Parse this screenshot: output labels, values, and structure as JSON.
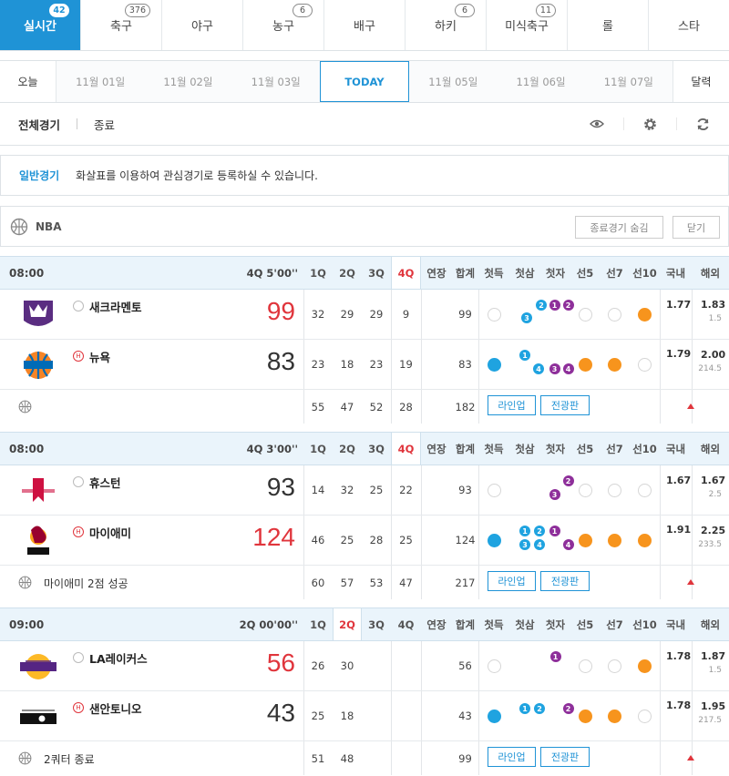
{
  "sports": [
    {
      "label": "실시간",
      "badge": "42",
      "active": true
    },
    {
      "label": "축구",
      "badge": "376"
    },
    {
      "label": "야구",
      "badge": ""
    },
    {
      "label": "농구",
      "badge": "6"
    },
    {
      "label": "배구",
      "badge": ""
    },
    {
      "label": "하키",
      "badge": "6"
    },
    {
      "label": "미식축구",
      "badge": "11"
    },
    {
      "label": "롤",
      "badge": ""
    },
    {
      "label": "스타",
      "badge": ""
    }
  ],
  "dates": {
    "left": "오늘",
    "items": [
      "11월 01일",
      "11월 02일",
      "11월 03일",
      "TODAY",
      "11월 05일",
      "11월 06일",
      "11월 07일"
    ],
    "right": "달력"
  },
  "filter": {
    "all": "전체경기",
    "finished": "종료"
  },
  "notice": {
    "title": "일반경기",
    "text": "화살표를 이용하여 관심경기로 등록하실 수 있습니다."
  },
  "league": {
    "name": "NBA",
    "hide_finished": "종료경기 숨김",
    "close": "닫기"
  },
  "columns": {
    "q1": "1Q",
    "q2": "2Q",
    "q3": "3Q",
    "q4": "4Q",
    "ot": "연장",
    "total": "합계",
    "first_score": "첫득",
    "first_3": "첫삼",
    "first_ft": "첫자",
    "to5": "선5",
    "to7": "선7",
    "to10": "선10",
    "domestic": "국내",
    "overseas": "해외"
  },
  "buttons": {
    "lineup": "라인업",
    "broadcast": "전광판"
  },
  "games": [
    {
      "time": "08:00",
      "status": "4Q 5'00''",
      "hl": "4Q",
      "away": {
        "name": "새크라멘토",
        "score": "99",
        "scoreRed": true,
        "q": [
          "32",
          "29",
          "29",
          "9"
        ],
        "ot": "",
        "total": "99",
        "dom": "1.77",
        "ovs": "1.83",
        "ovs_sub": "1.5"
      },
      "home": {
        "name": "뉴욕",
        "score": "83",
        "scoreRed": false,
        "q": [
          "23",
          "18",
          "23",
          "19"
        ],
        "ot": "",
        "total": "83",
        "dom": "1.79",
        "ovs": "2.00",
        "ovs_sub": "214.5"
      },
      "foot": {
        "text": "",
        "q": [
          "55",
          "47",
          "52",
          "28"
        ],
        "total": "182"
      }
    },
    {
      "time": "08:00",
      "status": "4Q 3'00''",
      "hl": "4Q",
      "away": {
        "name": "휴스턴",
        "score": "93",
        "scoreRed": false,
        "q": [
          "14",
          "32",
          "25",
          "22"
        ],
        "ot": "",
        "total": "93",
        "dom": "1.67",
        "ovs": "1.67",
        "ovs_sub": "2.5"
      },
      "home": {
        "name": "마이애미",
        "score": "124",
        "scoreRed": true,
        "q": [
          "46",
          "25",
          "28",
          "25"
        ],
        "ot": "",
        "total": "124",
        "dom": "1.91",
        "ovs": "2.25",
        "ovs_sub": "233.5"
      },
      "foot": {
        "text": "마이애미 2점 성공",
        "q": [
          "60",
          "57",
          "53",
          "47"
        ],
        "total": "217"
      }
    },
    {
      "time": "09:00",
      "status": "2Q 00'00''",
      "hl": "2Q",
      "away": {
        "name": "LA레이커스",
        "score": "56",
        "scoreRed": true,
        "q": [
          "26",
          "30",
          "",
          ""
        ],
        "ot": "",
        "total": "56",
        "dom": "1.78",
        "ovs": "1.87",
        "ovs_sub": "1.5"
      },
      "home": {
        "name": "샌안토니오",
        "score": "43",
        "scoreRed": false,
        "q": [
          "25",
          "18",
          "",
          ""
        ],
        "ot": "",
        "total": "43",
        "dom": "1.78",
        "ovs": "1.95",
        "ovs_sub": "217.5"
      },
      "foot": {
        "text": "2쿼터 종료",
        "q": [
          "51",
          "48",
          "",
          ""
        ],
        "total": "99"
      }
    }
  ],
  "icons": {
    "eye": "eye-icon",
    "gear": "gear-icon",
    "refresh": "refresh-icon",
    "ball": "basketball-icon"
  },
  "colors": {
    "accent": "#1f93d6",
    "red": "#e0353c",
    "orange": "#f7941d",
    "blue": "#1fa3e0",
    "purple": "#8e2f9a"
  }
}
